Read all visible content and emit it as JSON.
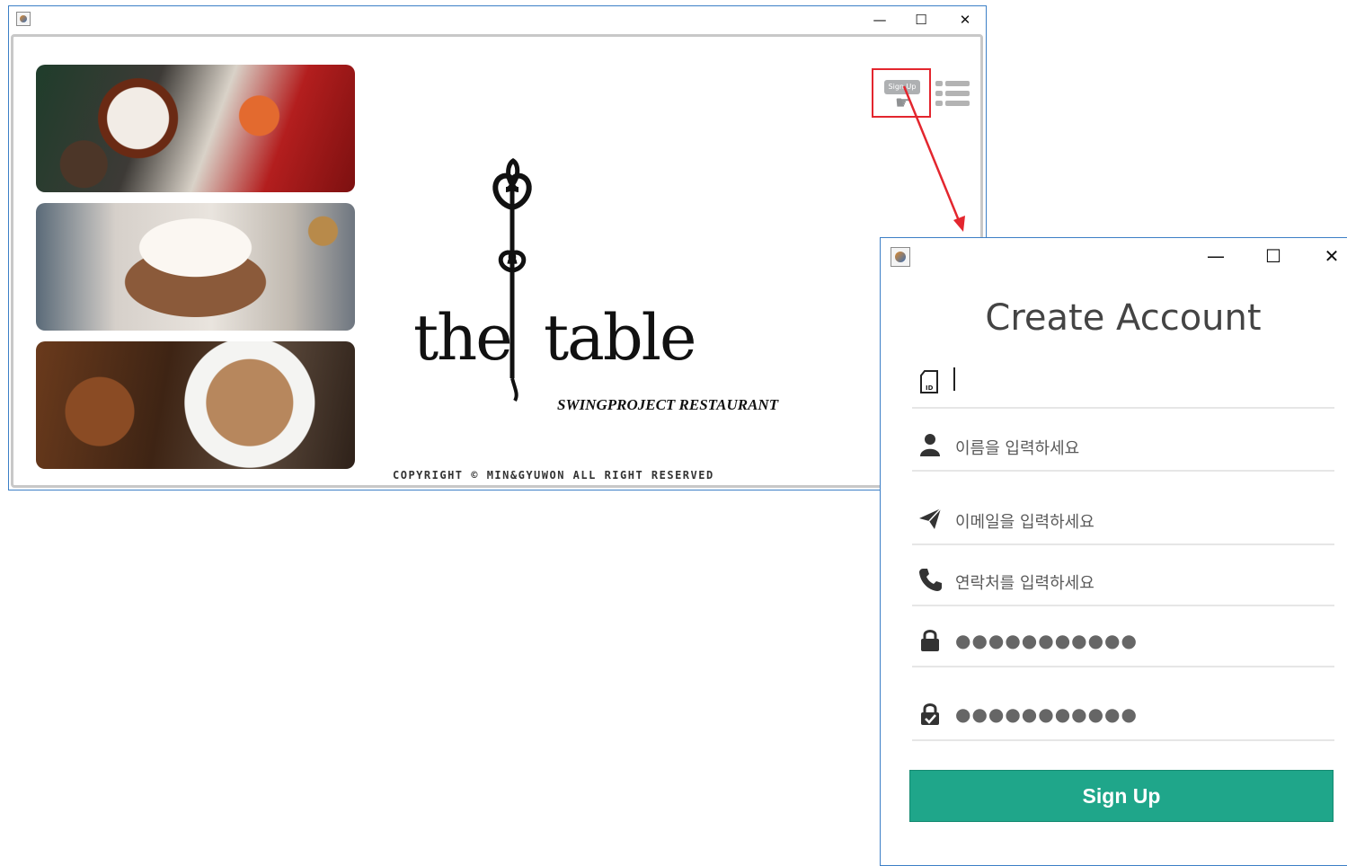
{
  "main_window": {
    "controls": {
      "minimize": "—",
      "maximize": "☐",
      "close": "✕"
    },
    "logo": {
      "word_left": "the",
      "word_right": "table",
      "subtitle": "SWINGPROJECT RESTAURANT"
    },
    "copyright": "COPYRIGHT © MIN&GYUWON ALL RIGHT RESERVED",
    "signup_button_label": "Sign Up",
    "photos": [
      "tea-with-orange-slice",
      "hot-chocolate-with-cream",
      "coffee-with-gingerbread"
    ]
  },
  "dialog": {
    "controls": {
      "minimize": "—",
      "maximize": "☐",
      "close": "✕"
    },
    "heading": "Create Account",
    "fields": {
      "id": {
        "value": "",
        "icon": "id-card-icon"
      },
      "name": {
        "placeholder": "이름을 입력하세요",
        "icon": "user-icon"
      },
      "email": {
        "placeholder": "이메일을 입력하세요",
        "icon": "paper-plane-icon"
      },
      "phone": {
        "placeholder": "연락처를 입력하세요",
        "icon": "phone-icon"
      },
      "password": {
        "value": "●●●●●●●●●●●",
        "icon": "lock-icon"
      },
      "password_confirm": {
        "value": "●●●●●●●●●●●",
        "icon": "lock-check-icon"
      }
    },
    "submit_label": "Sign Up"
  },
  "colors": {
    "accent": "#1fa68a",
    "highlight": "#e3262e",
    "window_border": "#3c7fc6"
  }
}
